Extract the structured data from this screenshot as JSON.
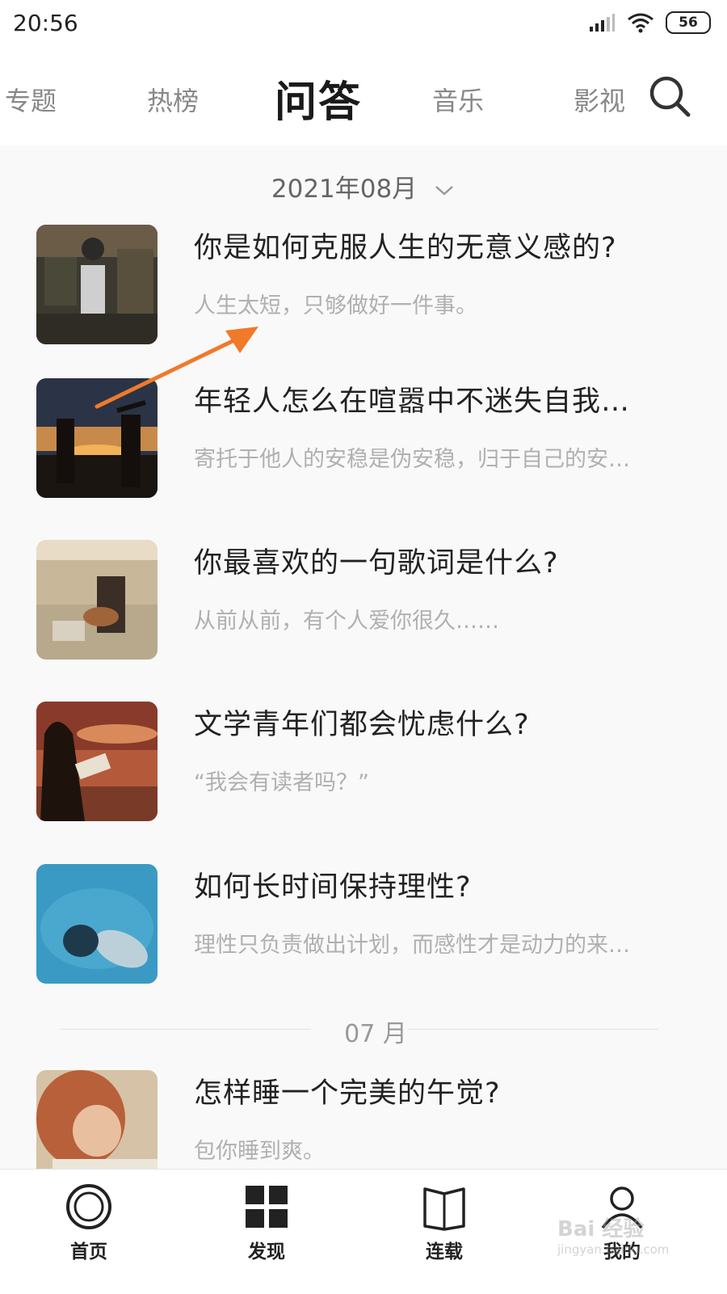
{
  "status_bar": {
    "time": "20:56",
    "battery": "56"
  },
  "tabs": [
    {
      "label": "专题"
    },
    {
      "label": "热榜"
    },
    {
      "label": "问答"
    },
    {
      "label": "音乐"
    },
    {
      "label": "影视"
    }
  ],
  "month_header": {
    "label": "2021年08月"
  },
  "items": [
    {
      "title": "你是如何克服人生的无意义感的?",
      "subtitle": "人生太短，只够做好一件事。"
    },
    {
      "title": "年轻人怎么在喧嚣中不迷失自我…",
      "subtitle": "寄托于他人的安稳是伪安稳，归于自己的安…"
    },
    {
      "title": "你最喜欢的一句歌词是什么?",
      "subtitle": "从前从前，有个人爱你很久……"
    },
    {
      "title": "文学青年们都会忧虑什么?",
      "subtitle": "“我会有读者吗？”"
    },
    {
      "title": "如何长时间保持理性?",
      "subtitle": "理性只负责做出计划，而感性才是动力的来…"
    },
    {
      "title": "怎样睡一个完美的午觉?",
      "subtitle": "包你睡到爽。"
    }
  ],
  "month_divider": {
    "label": "07 月"
  },
  "bottom_nav": [
    {
      "label": "首页",
      "icon": "home-circle-icon"
    },
    {
      "label": "发现",
      "icon": "grid-icon"
    },
    {
      "label": "连载",
      "icon": "book-icon"
    },
    {
      "label": "我的",
      "icon": "user-icon"
    }
  ],
  "annotation": {
    "color": "#f07a2a"
  },
  "watermark": {
    "line1": "Bai 经验",
    "line2": "jingyan.baidu.com"
  }
}
